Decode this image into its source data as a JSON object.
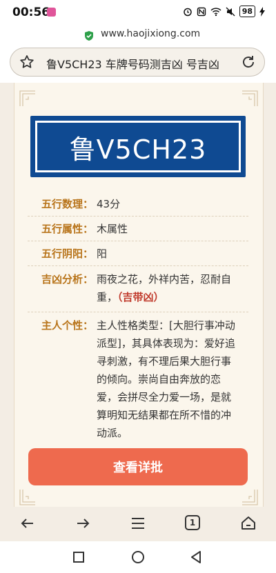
{
  "status_bar": {
    "time": "00:56",
    "battery": "98"
  },
  "browser": {
    "domain": "www.haojixiong.com",
    "page_title": "鲁V5CH23 车牌号码测吉凶 号吉凶",
    "tab_count": "1"
  },
  "plate": {
    "number": "鲁V5CH23",
    "bg_color": "#0f4a92"
  },
  "rows": [
    {
      "label": "五行数理：",
      "value": "43分"
    },
    {
      "label": "五行属性：",
      "value": "木属性"
    },
    {
      "label": "五行阴阳：",
      "value": "阳"
    },
    {
      "label": "吉凶分析：",
      "value": "雨夜之花，外祥内苦，忍耐自重，",
      "luck": "（吉带凶）"
    },
    {
      "label": "主人个性：",
      "value": "主人性格类型：[大胆行事冲动派型]，其具体表现为：爱好追寻刺激，有不理后果大胆行事的倾向。崇尚自由奔放的恋爱，会拼尽全力爱一场，是就算明知无结果都在所不惜的冲动派。"
    }
  ],
  "button": {
    "label": "查看详批",
    "color": "#ee6a4e"
  },
  "icons": [
    "star-icon",
    "reload-icon",
    "shield-icon",
    "back-icon",
    "forward-icon",
    "menu-icon",
    "tabs-icon",
    "home-icon"
  ]
}
